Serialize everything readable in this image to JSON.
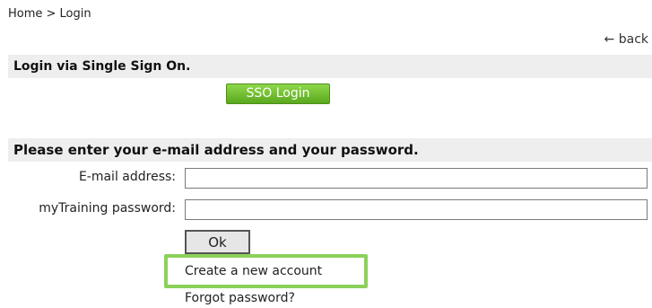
{
  "breadcrumb": "Home > Login",
  "back_label": "← back",
  "sso_section": {
    "heading": "Login via Single Sign On.",
    "button_label": "SSO Login"
  },
  "login_section": {
    "heading": "Please enter your e-mail address and your password.",
    "email_label": "E-mail address:",
    "email_value": "",
    "password_label": "myTraining password:",
    "password_value": "",
    "ok_label": "Ok",
    "create_account_label": "Create a new account",
    "forgot_password_label": "Forgot password?"
  },
  "colors": {
    "section_bar": "#eeeeee",
    "sso_button_green": "#6cbf2a",
    "highlight_green": "#8cd15a"
  }
}
